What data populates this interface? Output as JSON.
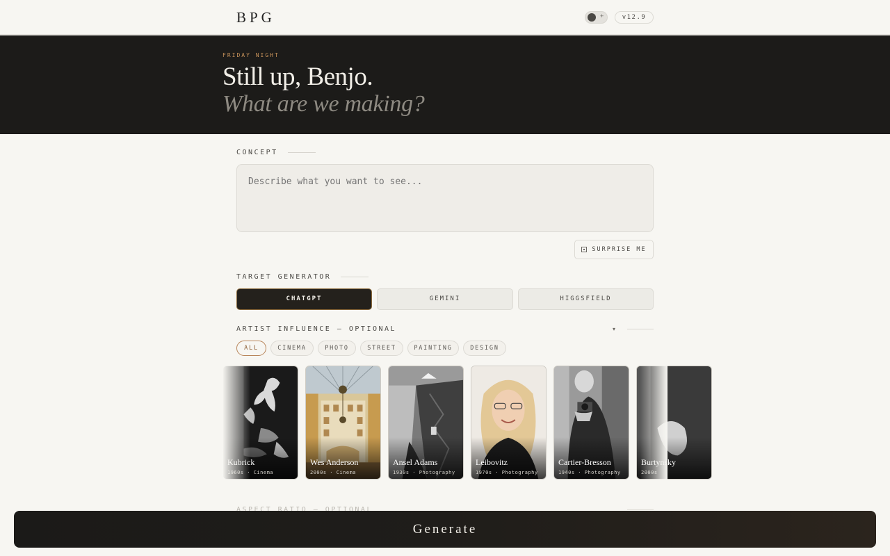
{
  "header": {
    "logo": "BPG",
    "version": "v12.9",
    "theme_toggle_symbol": "+"
  },
  "hero": {
    "eyebrow": "FRIDAY NIGHT",
    "title": "Still up, Benjo.",
    "subtitle": "What are we making?"
  },
  "concept": {
    "label": "CONCEPT",
    "placeholder": "Describe what you want to see...",
    "value": ""
  },
  "surprise": {
    "label": "SURPRISE ME"
  },
  "target": {
    "label": "TARGET GENERATOR",
    "options": [
      {
        "label": "CHATGPT",
        "active": true
      },
      {
        "label": "GEMINI",
        "active": false
      },
      {
        "label": "HIGGSFIELD",
        "active": false
      }
    ]
  },
  "artist": {
    "label": "ARTIST INFLUENCE — OPTIONAL",
    "filters": [
      "ALL",
      "CINEMA",
      "PHOTO",
      "STREET",
      "PAINTING",
      "DESIGN"
    ],
    "active_filter": "ALL",
    "cards": [
      {
        "name": "Kubrick",
        "meta": "1960s · Cinema"
      },
      {
        "name": "Wes Anderson",
        "meta": "2000s · Cinema"
      },
      {
        "name": "Ansel Adams",
        "meta": "1930s · Photography"
      },
      {
        "name": "Leibovitz",
        "meta": "1970s · Photography"
      },
      {
        "name": "Cartier-Bresson",
        "meta": "1940s · Photography"
      },
      {
        "name": "Burtynsky",
        "meta": "2000s"
      }
    ]
  },
  "aspect": {
    "label": "ASPECT RATIO — OPTIONAL"
  },
  "generate": {
    "label": "Generate"
  },
  "colors": {
    "accent": "#c7925a",
    "dark": "#1c1b19",
    "background": "#f7f6f2"
  }
}
